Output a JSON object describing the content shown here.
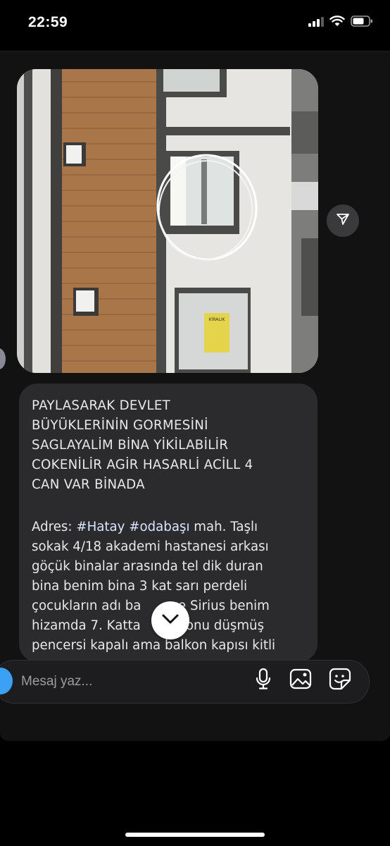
{
  "status_bar": {
    "time": "22:59",
    "icons": [
      "cellular-signal-icon",
      "wifi-icon",
      "battery-icon"
    ]
  },
  "message_photo": {
    "sign_text": "KİRALIK"
  },
  "message_text": {
    "caps": "PAYLASARAK DEVLET\nBÜYÜKLERİNİN GORMESİNİ\nSAGLAYALİM BİNA  YİKİLABİLİR\nCOKENİLİR AGİR HASARLİ ACİLL 4\nCAN VAR BİNADA",
    "address_prefix": "Adres: ",
    "hashtag_1": "#Hatay",
    "hashtag_2": "#odabaşı",
    "address_rest": " mah. Taşlı\nsokak 4/18 akademi hastanesi arkası\ngöçük binalar arasında tel dik duran\nbina benim bina 3 kat sarı perdeli\nçocukların adı ba",
    "segment_after_gap_1": " ve Sirius benim\nhizamda 7. Katta",
    "segment_after_gap_2": "osifonu düşmüş\npencersi kapalı ama balkon kapısı kitli"
  },
  "composer": {
    "placeholder": "Mesaj yaz..."
  },
  "colors": {
    "background": "#000000",
    "chat_background": "#121212",
    "bubble": "#2b2b2d",
    "camera_accent": "#3ba1f5"
  }
}
